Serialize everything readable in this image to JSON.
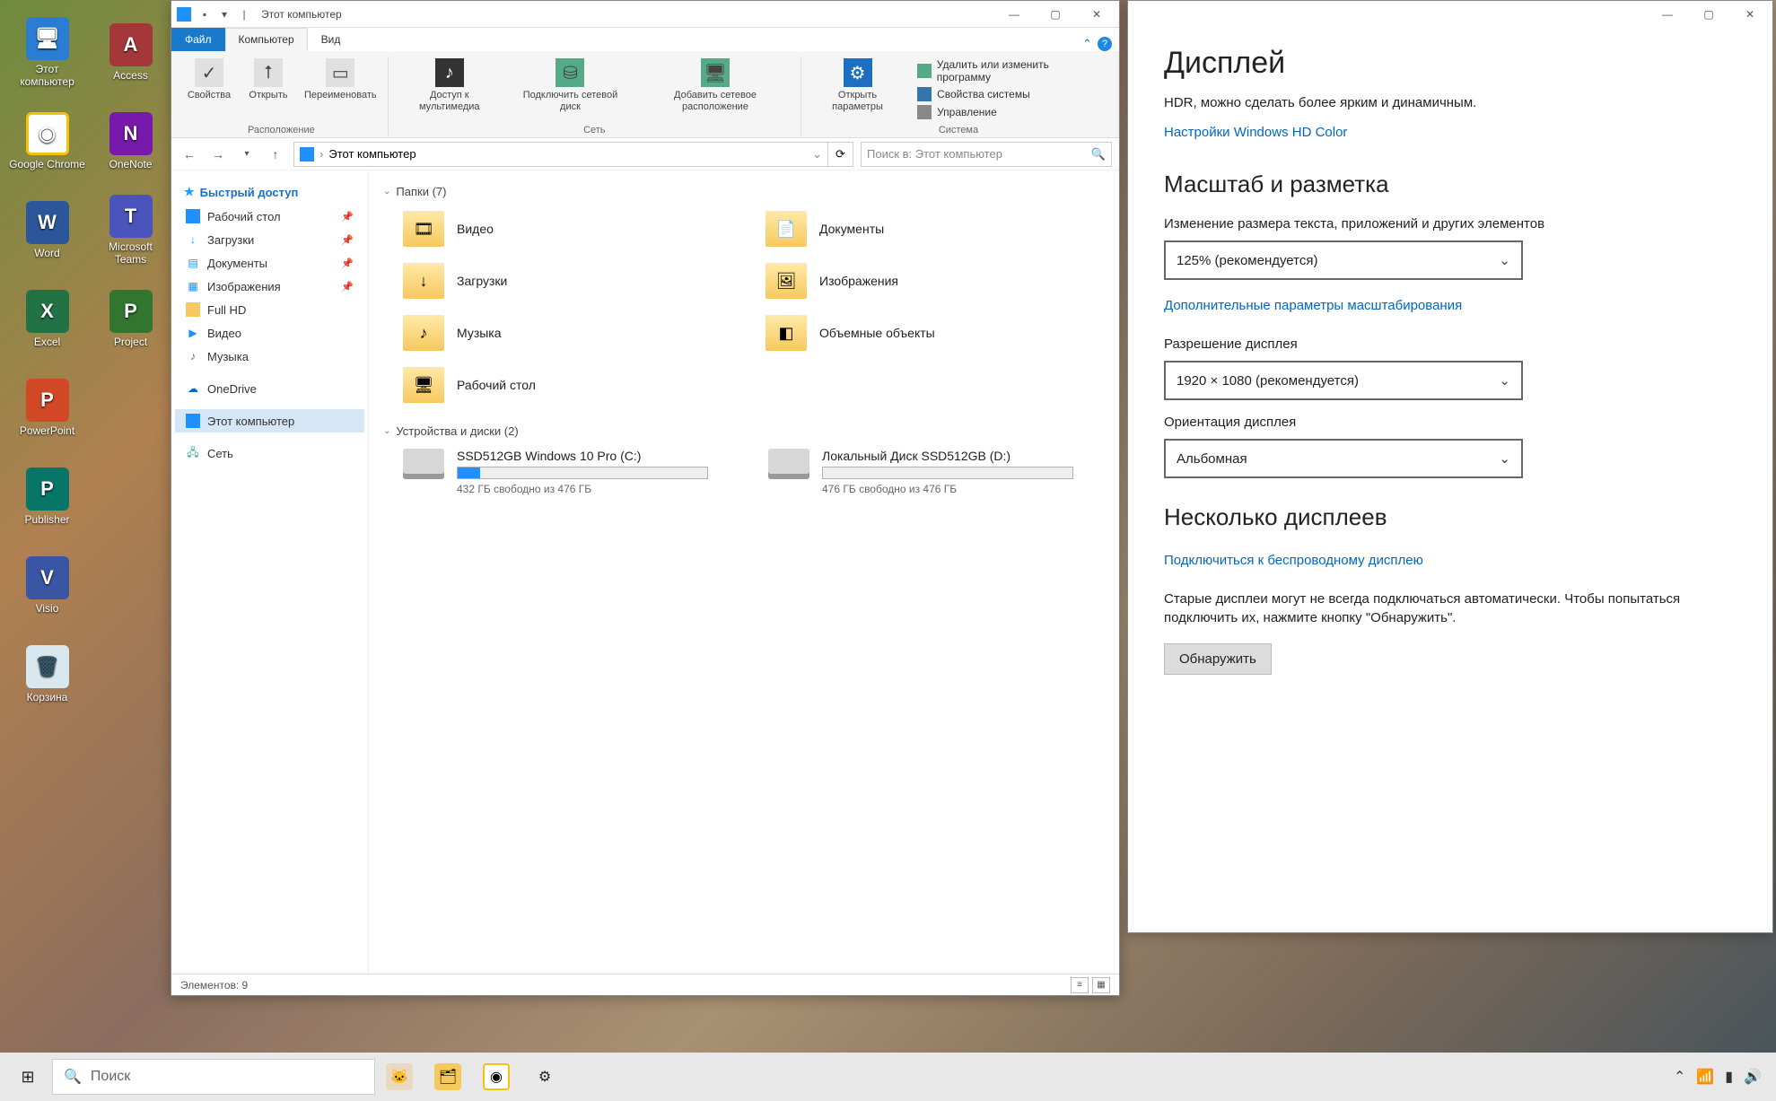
{
  "desktop": {
    "icons": [
      {
        "label": "Этот\nкомпьютер",
        "color": "#2b7cd3"
      },
      {
        "label": "Access",
        "color": "#a4373a"
      },
      {
        "label": "Google\nChrome",
        "color": "#fff",
        "ring": true
      },
      {
        "label": "OneNote",
        "color": "#7719aa"
      },
      {
        "label": "Word",
        "color": "#2b579a"
      },
      {
        "label": "Microsoft\nTeams",
        "color": "#4b53bc"
      },
      {
        "label": "Excel",
        "color": "#217346"
      },
      {
        "label": "Project",
        "color": "#31752f"
      },
      {
        "label": "PowerPoint",
        "color": "#d24726"
      },
      {
        "label": "",
        "color": "transparent"
      },
      {
        "label": "Publisher",
        "color": "#077568"
      },
      {
        "label": "",
        "color": "transparent"
      },
      {
        "label": "Visio",
        "color": "#3955a3"
      },
      {
        "label": "",
        "color": "transparent"
      },
      {
        "label": "Корзина",
        "color": "#d9e7ef"
      }
    ]
  },
  "explorer": {
    "title": "Этот компьютер",
    "tabs": {
      "file": "Файл",
      "computer": "Компьютер",
      "view": "Вид"
    },
    "ribbon": {
      "location": {
        "properties": "Свойства",
        "open": "Открыть",
        "rename": "Переименовать",
        "group": "Расположение"
      },
      "network": {
        "media": "Доступ к\nмультимедиа",
        "mapdrive": "Подключить\nсетевой диск",
        "addloc": "Добавить сетевое\nрасположение",
        "group": "Сеть"
      },
      "system": {
        "settings": "Открыть\nпараметры",
        "links": [
          "Удалить или изменить программу",
          "Свойства системы",
          "Управление"
        ],
        "group": "Система"
      }
    },
    "address": "Этот компьютер",
    "search_placeholder": "Поиск в: Этот компьютер",
    "nav": {
      "quick": "Быстрый доступ",
      "items": [
        {
          "label": "Рабочий стол",
          "pin": true,
          "color": "#1e88e5"
        },
        {
          "label": "Загрузки",
          "pin": true,
          "color": "#1e88e5"
        },
        {
          "label": "Документы",
          "pin": true,
          "color": "#1e88e5"
        },
        {
          "label": "Изображения",
          "pin": true,
          "color": "#1e88e5"
        },
        {
          "label": "Full HD",
          "pin": false,
          "color": "#f6c95e"
        },
        {
          "label": "Видео",
          "pin": false,
          "color": "#1e88e5"
        },
        {
          "label": "Музыка",
          "pin": false,
          "color": "#666"
        }
      ],
      "onedrive": "OneDrive",
      "thispc": "Этот компьютер",
      "network": "Сеть"
    },
    "folders_header": "Папки (7)",
    "folders": [
      {
        "label": "Видео"
      },
      {
        "label": "Документы"
      },
      {
        "label": "Загрузки"
      },
      {
        "label": "Изображения"
      },
      {
        "label": "Музыка"
      },
      {
        "label": "Объемные объекты"
      },
      {
        "label": "Рабочий стол"
      }
    ],
    "drives_header": "Устройства и диски (2)",
    "drives": [
      {
        "name": "SSD512GB Windows 10 Pro (C:)",
        "free": "432 ГБ свободно из 476 ГБ",
        "pct": 9
      },
      {
        "name": "Локальный Диск SSD512GB (D:)",
        "free": "476 ГБ свободно из 476 ГБ",
        "pct": 0
      }
    ],
    "status": "Элементов: 9"
  },
  "settings": {
    "title": "Дисплей",
    "hdr_line": "HDR, можно сделать более ярким и динамичным.",
    "hdr_link": "Настройки Windows HD Color",
    "scale_h": "Масштаб и разметка",
    "scale_label": "Изменение размера текста, приложений и других элементов",
    "scale_value": "125% (рекомендуется)",
    "adv_scale": "Дополнительные параметры масштабирования",
    "res_label": "Разрешение дисплея",
    "res_value": "1920 × 1080 (рекомендуется)",
    "orient_label": "Ориентация дисплея",
    "orient_value": "Альбомная",
    "multi_h": "Несколько дисплеев",
    "wireless": "Подключиться к беспроводному дисплею",
    "old_text": "Старые дисплеи могут не всегда подключаться автоматически. Чтобы попытаться подключить их, нажмите кнопку \"Обнаружить\".",
    "detect": "Обнаружить"
  },
  "taskbar": {
    "search": "Поиск"
  }
}
